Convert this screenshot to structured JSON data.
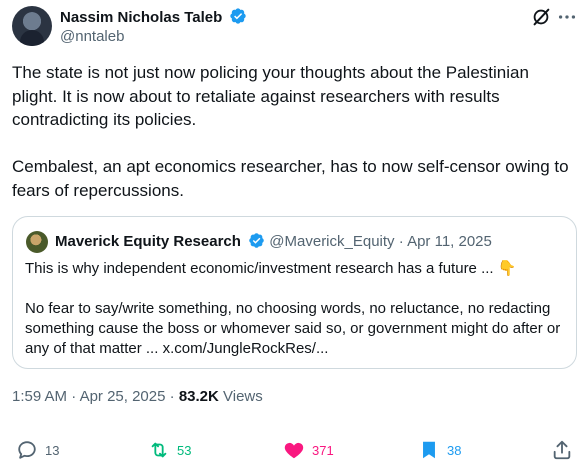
{
  "author": {
    "name": "Nassim Nicholas Taleb",
    "handle": "@nntaleb",
    "verified": true
  },
  "tweet": {
    "text": "The state is not just now policing your thoughts about the Palestinian plight. It is now about to retaliate against researchers with results contradicting its policies.\n\nCembalest, an apt economics researcher, has to now self-censor owing to fears of repercussions."
  },
  "quoted_tweet": {
    "name": "Maverick Equity Research",
    "handle": "@Maverick_Equity",
    "separator": "·",
    "date": "Apr 11, 2025",
    "verified": true,
    "text": "This is why independent economic/investment research has a future ... 👇\n\nNo fear to say/write something, no choosing words, no reluctance, no redacting something cause the boss or whomever said so, or government might do after or any of that matter ... x.com/JungleRockRes/..."
  },
  "meta": {
    "time": "1:59 AM",
    "separator1": "·",
    "date": "Apr 25, 2025",
    "separator2": "·",
    "views_count": "83.2K",
    "views_label": "Views"
  },
  "actions": {
    "replies": "13",
    "reposts": "53",
    "likes": "371",
    "bookmarks": "38"
  },
  "icons": {
    "top_right": [
      "grok-icon",
      "more-icon"
    ],
    "actions": [
      "reply-icon",
      "repost-icon",
      "heart-icon",
      "bookmark-icon",
      "share-icon"
    ]
  },
  "colors": {
    "verified": "#1d9bf0",
    "repost": "#00ba7c",
    "like": "#f91880",
    "bookmark": "#1d9bf0",
    "secondary_text": "#536471",
    "primary_text": "#0f1419"
  }
}
